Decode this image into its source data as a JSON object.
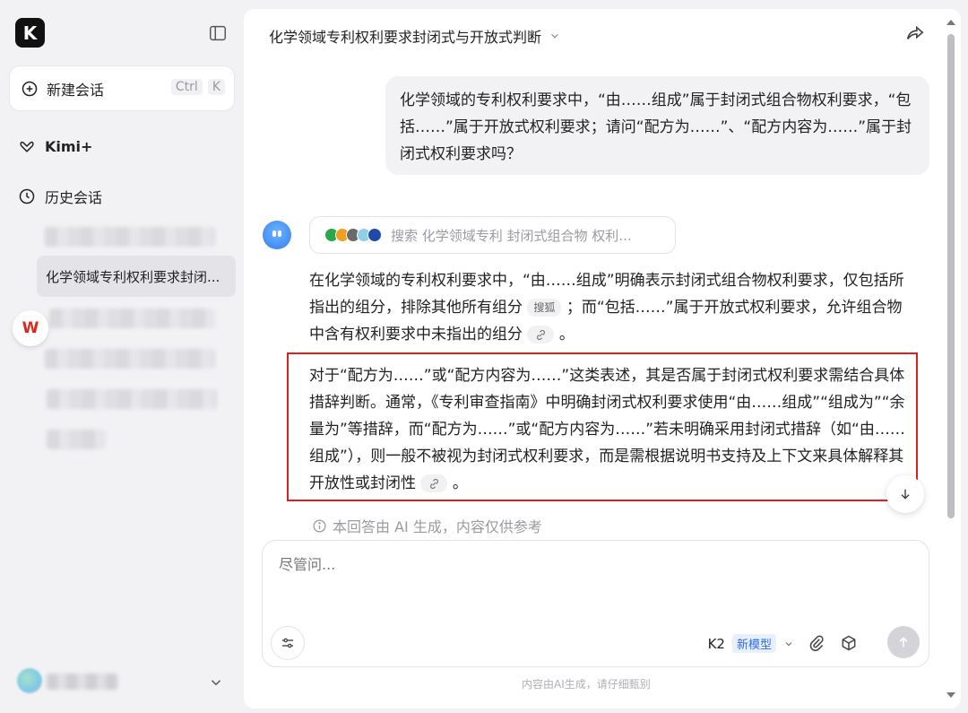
{
  "sidebar": {
    "logo_letter": "K",
    "new_chat_label": "新建会话",
    "shortcut_keys": [
      "Ctrl",
      "K"
    ],
    "kimi_plus_label": "Kimi+",
    "history_label": "历史会话",
    "active_history_item": "化学领域专利权利要求封闭...",
    "wps_badge": "W"
  },
  "header": {
    "title": "化学领域专利权利要求封闭式与开放式判断"
  },
  "conversation": {
    "user_message": "化学领域的专利权利要求中，“由……组成”属于封闭式组合物权利要求，“包括……”属于开放式权利要求；请问“配方为……”、“配方内容为……”属于封闭式权利要求吗？",
    "search_summary": "搜索 化学领域专利 封闭式组合物 权利...",
    "answer_p1_a": "在化学领域的专利权利要求中，“由……组成”明确表示封闭式组合物权利要求，仅包括所指出的组分，排除其他所有组分",
    "answer_p1_cite": "搜狐",
    "answer_p1_b": "；而“包括……”属于开放式权利要求，允许组合物中含有权利要求中未指出的组分",
    "answer_p1_end": "。",
    "answer_p2": "对于“配方为……”或“配方内容为……”这类表述，其是否属于封闭式权利要求需结合具体措辞判断。通常，《专利审查指南》中明确封闭式权利要求使用“由……组成”“组成为”“余量为”等措辞，而“配方为……”或“配方内容为……”若未明确采用封闭式措辞（如“由……组成”），则一般不被视为封闭式权利要求，而是需根据说明书支持及上下文来具体解释其开放性或封闭性",
    "answer_p2_end": "。",
    "disclaimer": "本回答由 AI 生成，内容仅供参考"
  },
  "composer": {
    "placeholder": "尽管问...",
    "model_name": "K2",
    "new_model_tag": "新模型"
  },
  "footer_note": "内容由AI生成，请仔细甄别",
  "colors": {
    "accent_blue": "#2f6bf0",
    "highlight_red": "#e02020"
  }
}
